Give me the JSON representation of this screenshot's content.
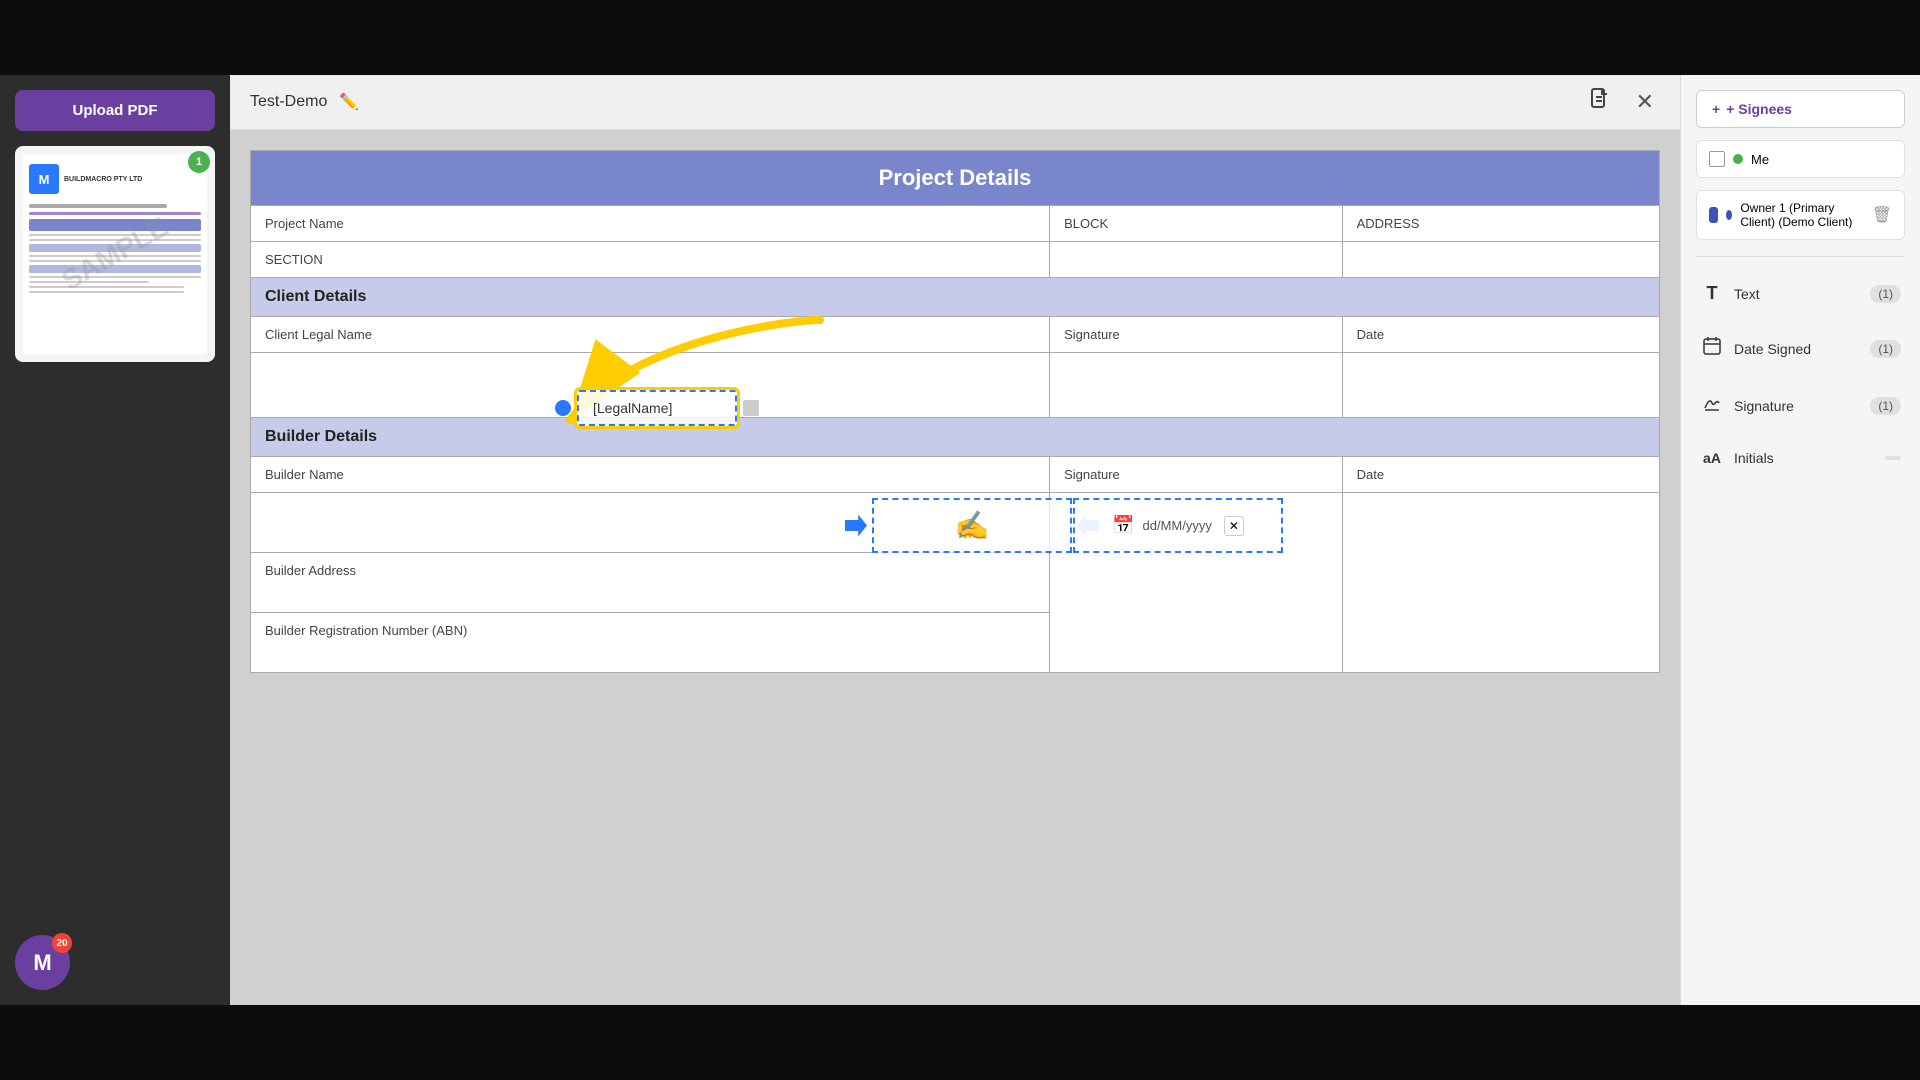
{
  "app": {
    "title": "Test-Demo",
    "notification_count": "20"
  },
  "toolbar": {
    "title": "Test-Demo",
    "edit_label": "✏️",
    "close_label": "✕"
  },
  "upload_btn": {
    "label": "Upload PDF"
  },
  "document": {
    "watermark": "SAMPLE",
    "project_details": {
      "title": "Project Details",
      "col1": "Project Name",
      "col2": "BLOCK",
      "col3": "ADDRESS",
      "row2_col1": "SECTION"
    },
    "legal_name_field": "[LegalName]",
    "client_details": {
      "section_title": "Client Details",
      "col1": "Client Legal Name",
      "col2": "Signature",
      "col3": "Date",
      "date_placeholder": "dd/MM/yyyy"
    },
    "builder_details": {
      "section_title": "Builder Details",
      "col1_row1": "Builder Name",
      "col1_row2": "Builder Address",
      "col1_row3": "Builder Registration Number (ABN)",
      "col2": "Signature",
      "col3": "Date"
    }
  },
  "right_panel": {
    "add_signees_label": "+ Signees",
    "signees": [
      {
        "name": "Me",
        "dot_color": "green"
      },
      {
        "name": "Owner 1 (Primary Client) (Demo Client)",
        "dot_color": "blue",
        "avatar": true
      }
    ],
    "field_types": [
      {
        "icon": "T",
        "label": "Text",
        "count": "(1)"
      },
      {
        "icon": "📅",
        "label": "Date Signed",
        "count": "(1)"
      },
      {
        "icon": "✍",
        "label": "Signature",
        "count": "(1)"
      },
      {
        "icon": "aA",
        "label": "Initials",
        "count": ""
      }
    ]
  }
}
